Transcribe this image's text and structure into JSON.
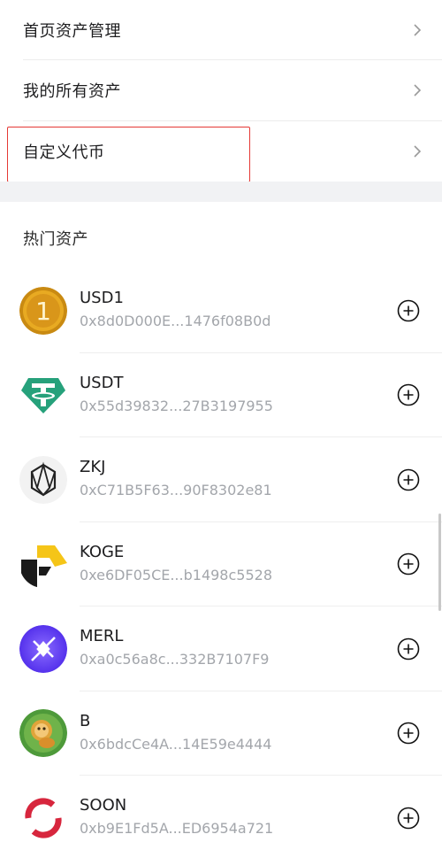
{
  "menu": {
    "items": [
      {
        "label": "首页资产管理"
      },
      {
        "label": "我的所有资产"
      },
      {
        "label": "自定义代币"
      }
    ]
  },
  "hot_assets": {
    "title": "热门资产",
    "items": [
      {
        "symbol": "USD1",
        "address": "0x8d0D000E...1476f08B0d",
        "icon": "usd1-coin-icon"
      },
      {
        "symbol": "USDT",
        "address": "0x55d39832...27B3197955",
        "icon": "usdt-coin-icon"
      },
      {
        "symbol": "ZKJ",
        "address": "0xC71B5F63...90F8302e81",
        "icon": "zkj-coin-icon"
      },
      {
        "symbol": "KOGE",
        "address": "0xe6DF05CE...b1498c5528",
        "icon": "koge-coin-icon"
      },
      {
        "symbol": "MERL",
        "address": "0xa0c56a8c...332B7107F9",
        "icon": "merl-coin-icon"
      },
      {
        "symbol": "B",
        "address": "0x6bdcCe4A...14E59e4444",
        "icon": "b-coin-icon"
      },
      {
        "symbol": "SOON",
        "address": "0xb9E1Fd5A...ED6954a721",
        "icon": "soon-coin-icon"
      }
    ]
  },
  "colors": {
    "highlight": "#e53935",
    "usdt": "#26a17b",
    "usd1": "#e3a419",
    "merl": "#5b3bff",
    "koge": "#f5c518",
    "soon": "#d7263d"
  }
}
